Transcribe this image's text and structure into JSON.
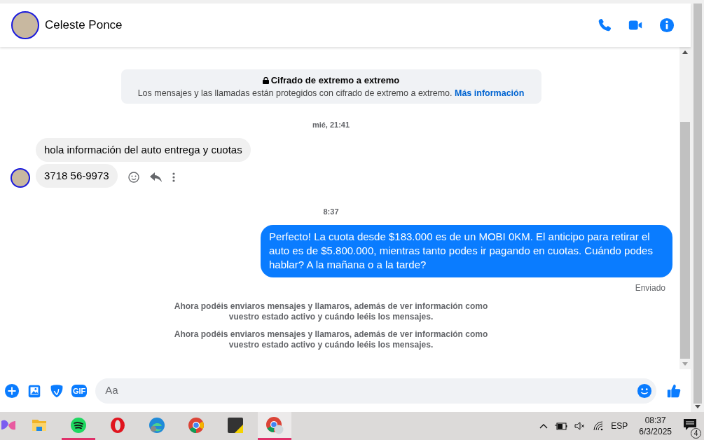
{
  "header": {
    "name": "Celeste Ponce"
  },
  "encryption": {
    "title": "Cifrado de extremo a extremo",
    "text": "Los mensajes y las llamadas están protegidos con cifrado de extremo a extremo.",
    "link": "Más información"
  },
  "messages": [
    {
      "kind": "timestamp",
      "text": "mié, 21:41"
    },
    {
      "kind": "incoming",
      "bubbles": [
        "hola información del auto entrega y cuotas",
        "3718 56-9973"
      ]
    },
    {
      "kind": "timestamp",
      "text": "8:37"
    },
    {
      "kind": "outgoing",
      "bubbles": [
        "Perfecto! La cuota desde $183.000 es de un MOBI 0KM. El anticipo para retirar el auto es de $5.800.000, mientras tanto podes ir pagando en cuotas. Cuándo podes hablar? A la mañana o a la tarde?"
      ],
      "status": "Enviado"
    },
    {
      "kind": "notice",
      "text": "Ahora podéis enviaros mensajes y llamaros, además de ver información como vuestro estado activo y cuándo leéis los mensajes."
    },
    {
      "kind": "notice",
      "text": "Ahora podéis enviaros mensajes y llamaros, además de ver información como vuestro estado activo y cuándo leéis los mensajes."
    }
  ],
  "composer": {
    "gif_label": "GIF",
    "placeholder": "Aa"
  },
  "taskbar": {
    "apps": [
      {
        "kind": "copilot",
        "active": false
      },
      {
        "kind": "folder",
        "active": false
      },
      {
        "kind": "spotify",
        "active": true
      },
      {
        "kind": "opera",
        "active": false
      },
      {
        "kind": "edge",
        "active": false
      },
      {
        "kind": "chrome",
        "active": false
      },
      {
        "kind": "sticky",
        "active": false
      },
      {
        "kind": "chrome-profile",
        "active": true
      }
    ],
    "language": "ESP",
    "time": "08:37",
    "date": "6/3/2025",
    "notifications": "4"
  }
}
